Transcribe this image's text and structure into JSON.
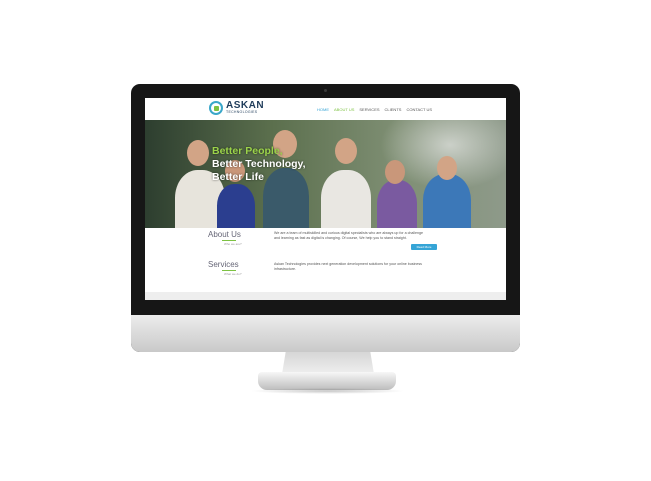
{
  "site": {
    "logo": {
      "name": "ASKAN",
      "subtitle": "TECHNOLOGIES"
    },
    "nav": [
      "HOME",
      "ABOUT US",
      "SERVICES",
      "CLIENTS",
      "CONTACT US"
    ],
    "hero": {
      "line1": "Better People,",
      "line2": "Better Technology,",
      "line3": "Better Life"
    },
    "about": {
      "title": "About Us",
      "subtitle": "Who we are?",
      "text": "We are a team of multiskilled and curious digital specialists who are always up for a challenge and learning as fast as digital is changing. Of course, We help you to stand straight.",
      "button": "Read More"
    },
    "services": {
      "title": "Services",
      "subtitle": "What we do?",
      "text": "Askan Technologies provides next generation development solutions for your online business infrastructure."
    }
  },
  "colors": {
    "brand_blue": "#35a4d6",
    "brand_green": "#9bd34a",
    "bezel": "#161616"
  }
}
